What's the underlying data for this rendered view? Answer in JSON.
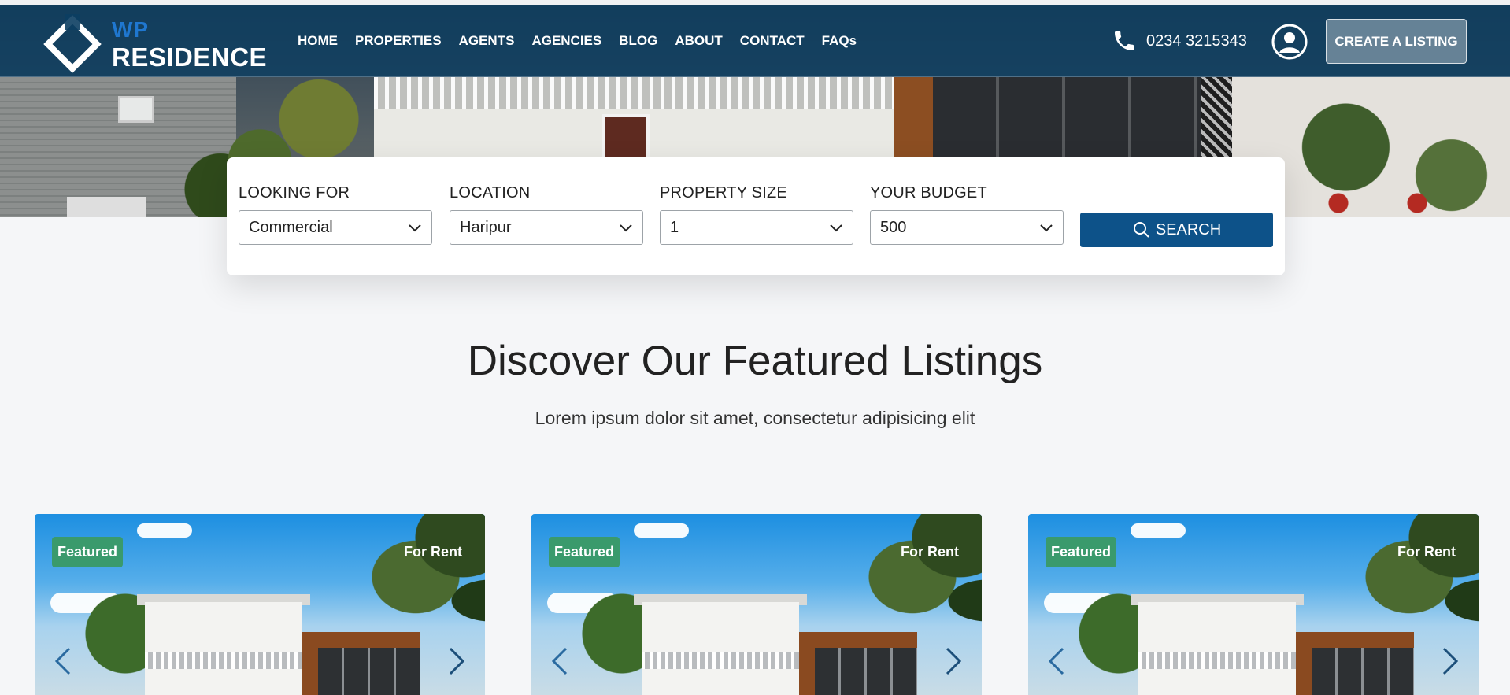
{
  "brand": {
    "logo_top": "WP",
    "logo_bottom": "RESIDENCE"
  },
  "nav": {
    "items": [
      {
        "label": "HOME"
      },
      {
        "label": "PROPERTIES"
      },
      {
        "label": "AGENTS"
      },
      {
        "label": "AGENCIES"
      },
      {
        "label": "BLOG"
      },
      {
        "label": "ABOUT"
      },
      {
        "label": "CONTACT"
      },
      {
        "label": "FAQs"
      }
    ],
    "phone": "0234 3215343",
    "phone_icon": "phone-icon",
    "user_icon": "user-circle-icon",
    "cta_label": "CREATE A LISTING"
  },
  "search": {
    "fields": [
      {
        "label": "LOOKING FOR",
        "value": "Commercial"
      },
      {
        "label": "LOCATION",
        "value": "Haripur"
      },
      {
        "label": "PROPERTY SIZE",
        "value": "1"
      },
      {
        "label": "YOUR BUDGET",
        "value": "500"
      }
    ],
    "button_label": "SEARCH",
    "button_icon": "search-icon"
  },
  "section": {
    "title": "Discover Our Featured Listings",
    "subtitle": "Lorem ipsum dolor sit amet, consectetur adipisicing elit"
  },
  "cards": [
    {
      "badge_left": "Featured",
      "badge_right": "For Rent"
    },
    {
      "badge_left": "Featured",
      "badge_right": "For Rent"
    },
    {
      "badge_left": "Featured",
      "badge_right": "For Rent"
    }
  ],
  "colors": {
    "navbar": "#0c3e62",
    "primary_button": "#0d5289",
    "featured_badge": "#3a9a6c",
    "logo_accent": "#1f77d0"
  }
}
